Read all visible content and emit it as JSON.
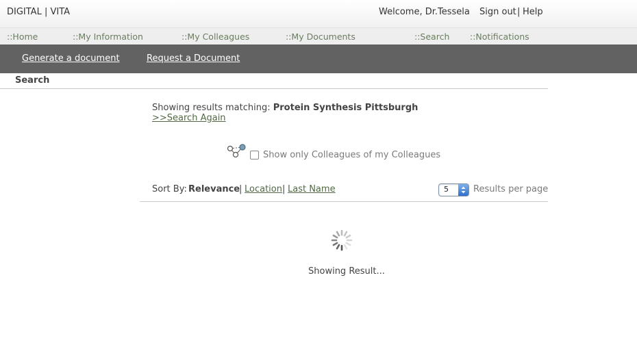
{
  "header": {
    "brand": "DIGITAL | VITA",
    "welcome": "Welcome, Dr.Tessela",
    "sign_out": "Sign out",
    "separator": "|",
    "help": "Help"
  },
  "nav": {
    "items": [
      {
        "label": "::Home"
      },
      {
        "label": "::My Information"
      },
      {
        "label": "::My Colleagues"
      },
      {
        "label": "::My Documents"
      },
      {
        "label": "::Search"
      },
      {
        "label": "::Notifications"
      }
    ]
  },
  "subnav": {
    "generate": "Generate a document",
    "request": "Request a Document"
  },
  "section": {
    "title": "Search"
  },
  "results": {
    "prefix": "Showing results matching:",
    "query": "Protein Synthesis Pittsburgh",
    "search_again": ">>Search Again"
  },
  "filter": {
    "icon": "network-icon",
    "checked": false,
    "label": "Show only Colleagues of my Colleagues"
  },
  "sort": {
    "label": "Sort By:",
    "active": "Relevance",
    "sep": "|",
    "location": "Location",
    "last_name": "Last Name"
  },
  "per_page": {
    "value": "5",
    "label": "Results per page"
  },
  "loading": {
    "icon": "spinner-icon",
    "text": "Showing Result..."
  },
  "colors": {
    "subnav_bg": "#626262",
    "link_green": "#4f6a43",
    "nav_green": "#6a7d60"
  }
}
